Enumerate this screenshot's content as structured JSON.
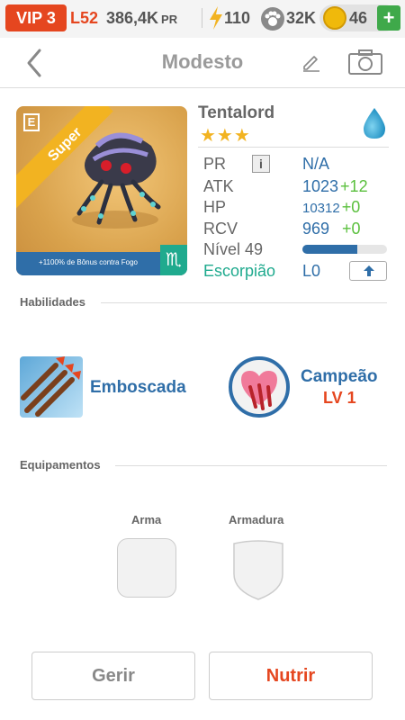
{
  "statusbar": {
    "vip": "VIP 3",
    "level": "L52",
    "power": "386,4K",
    "power_unit": "PR",
    "energy": "110",
    "food": "32K",
    "coins": "46",
    "plus": "+"
  },
  "header": {
    "title": "Modesto"
  },
  "monster": {
    "name": "Tentalord",
    "stars": "★★★",
    "rarity_tag": "Super",
    "card_tag": "E",
    "bonus_text": "+1100% de Bônus contra Fogo",
    "sign_symbol": "♏",
    "element": "water"
  },
  "stats": {
    "pr_label": "PR",
    "pr_info": "i",
    "pr_value": "N/A",
    "atk_label": "ATK",
    "atk_value": "1023",
    "atk_bonus": "+12",
    "hp_label": "HP",
    "hp_value": "10312",
    "hp_bonus": "+0",
    "rcv_label": "RCV",
    "rcv_value": "969",
    "rcv_bonus": "+0",
    "level_label": "Nível 49",
    "level_progress": 0.65,
    "sign_label": "Escorpião",
    "sign_level": "L0"
  },
  "sections": {
    "skills_title": "Habilidades",
    "equipment_title": "Equipamentos"
  },
  "skills": [
    {
      "name": "Emboscada"
    },
    {
      "name": "Campeão",
      "level": "LV 1"
    }
  ],
  "equipment": {
    "weapon_label": "Arma",
    "armor_label": "Armadura"
  },
  "buttons": {
    "manage": "Gerir",
    "feed": "Nutrir"
  },
  "colors": {
    "accent_red": "#e5461f",
    "accent_blue": "#2f6ea8",
    "accent_green": "#5bc03e",
    "zodiac_teal": "#1faa8e",
    "star_gold": "#f2b321"
  }
}
